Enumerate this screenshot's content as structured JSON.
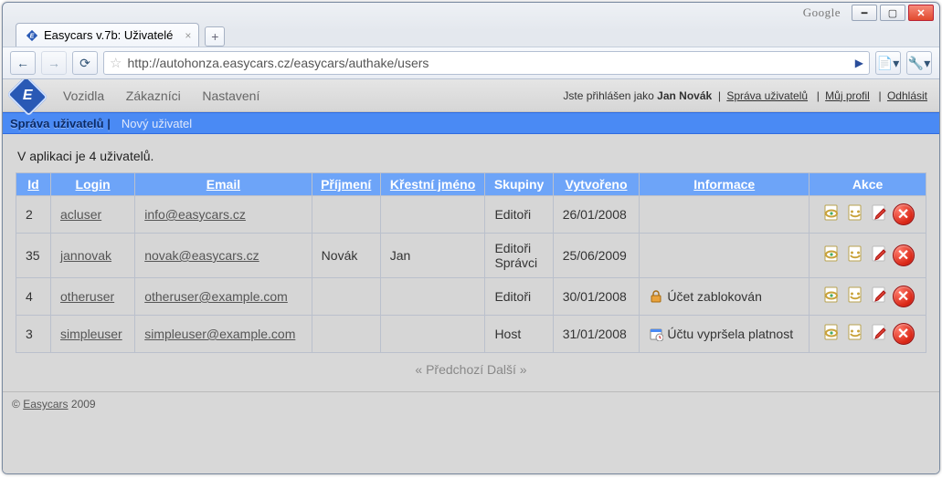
{
  "browser": {
    "tab_title": "Easycars v.7b: Uživatelé",
    "url": "http://autohonza.easycars.cz/easycars/authake/users",
    "brand": "Google"
  },
  "header": {
    "nav": {
      "vozidla": "Vozidla",
      "zakaznici": "Zákazníci",
      "nastaveni": "Nastavení"
    },
    "logged_prefix": "Jste přihlášen jako ",
    "logged_user": "Jan Novák",
    "links": {
      "sprava": "Správa uživatelů",
      "profil": "Můj profil",
      "odhlasit": "Odhlásit"
    }
  },
  "subheader": {
    "active": "Správa uživatelů",
    "new_user": "Nový uživatel"
  },
  "summary": "V aplikaci je 4 uživatelů.",
  "columns": {
    "id": "Id",
    "login": "Login",
    "email": "Email",
    "prijmeni": "Příjmení",
    "jmeno": "Křestní jméno",
    "skupiny": "Skupiny",
    "vytvoreno": "Vytvořeno",
    "informace": "Informace",
    "akce": "Akce"
  },
  "rows": [
    {
      "id": "2",
      "login": "acluser",
      "email": "info@easycars.cz",
      "prijmeni": "",
      "jmeno": "",
      "skupiny": "Editoři",
      "vytvoreno": "26/01/2008",
      "info_icon": "",
      "info": ""
    },
    {
      "id": "35",
      "login": "jannovak",
      "email": "novak@easycars.cz",
      "prijmeni": "Novák",
      "jmeno": "Jan",
      "skupiny": "Editoři\nSprávci",
      "vytvoreno": "25/06/2009",
      "info_icon": "",
      "info": ""
    },
    {
      "id": "4",
      "login": "otheruser",
      "email": "otheruser@example.com",
      "prijmeni": "",
      "jmeno": "",
      "skupiny": "Editoři",
      "vytvoreno": "30/01/2008",
      "info_icon": "lock",
      "info": "Účet zablokován"
    },
    {
      "id": "3",
      "login": "simpleuser",
      "email": "simpleuser@example.com",
      "prijmeni": "",
      "jmeno": "",
      "skupiny": "Host",
      "vytvoreno": "31/01/2008",
      "info_icon": "expired",
      "info": "Účtu vypršela platnost"
    }
  ],
  "pager": {
    "prev": "« Předchozí",
    "next": "Další »"
  },
  "footer": {
    "copy": "©",
    "brand": "Easycars",
    "year": "2009"
  }
}
